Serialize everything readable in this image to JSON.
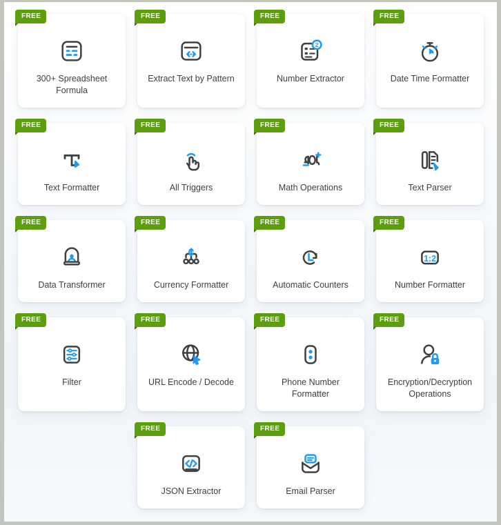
{
  "page": {
    "badge_text": "FREE",
    "accent_blue": "#1e9bf0",
    "badge_green": "#5d9e0e",
    "outline_gray": "#3d4043",
    "card_bg": "#ffffff",
    "page_bg": "#f4f8fb"
  },
  "cards": [
    {
      "label": "300+ Spreadsheet Formula",
      "badge": "FREE",
      "icon": "spreadsheet-icon",
      "col": 1,
      "row": 1
    },
    {
      "label": "Extract Text by Pattern",
      "badge": "FREE",
      "icon": "extract-text-pattern-icon",
      "col": 2,
      "row": 1
    },
    {
      "label": "Number Extractor",
      "badge": "FREE",
      "icon": "number-extractor-icon",
      "col": 3,
      "row": 1
    },
    {
      "label": "Date Time Formatter",
      "badge": "FREE",
      "icon": "stopwatch-icon",
      "col": 4,
      "row": 1
    },
    {
      "label": "Text Formatter",
      "badge": "FREE",
      "icon": "text-formatter-icon",
      "col": 1,
      "row": 2
    },
    {
      "label": "All Triggers",
      "badge": "FREE",
      "icon": "tap-hand-icon",
      "col": 2,
      "row": 2
    },
    {
      "label": "Math Operations",
      "badge": "FREE",
      "icon": "math-operations-icon",
      "col": 3,
      "row": 2
    },
    {
      "label": "Text Parser",
      "badge": "FREE",
      "icon": "text-parser-icon",
      "col": 4,
      "row": 2
    },
    {
      "label": "Data Transformer",
      "badge": "FREE",
      "icon": "data-transformer-icon",
      "col": 1,
      "row": 3
    },
    {
      "label": "Currency Formatter",
      "badge": "FREE",
      "icon": "currency-formatter-icon",
      "col": 2,
      "row": 3
    },
    {
      "label": "Automatic Counters",
      "badge": "FREE",
      "icon": "automatic-counters-icon",
      "col": 3,
      "row": 3
    },
    {
      "label": "Number Formatter",
      "badge": "FREE",
      "icon": "number-formatter-icon",
      "col": 4,
      "row": 3
    },
    {
      "label": "Filter",
      "badge": "FREE",
      "icon": "filter-sliders-icon",
      "col": 1,
      "row": 4
    },
    {
      "label": "URL Encode / Decode",
      "badge": "FREE",
      "icon": "url-globe-icon",
      "col": 2,
      "row": 4
    },
    {
      "label": "Phone Number Formatter",
      "badge": "FREE",
      "icon": "phone-number-icon",
      "col": 3,
      "row": 4
    },
    {
      "label": "Encryption/Decryption Operations",
      "badge": "FREE",
      "icon": "user-lock-icon",
      "col": 4,
      "row": 4
    },
    {
      "label": "JSON Extractor",
      "badge": "FREE",
      "icon": "code-brackets-icon",
      "col": 2,
      "row": 5
    },
    {
      "label": "Email Parser",
      "badge": "FREE",
      "icon": "email-envelope-icon",
      "col": 3,
      "row": 5
    }
  ]
}
